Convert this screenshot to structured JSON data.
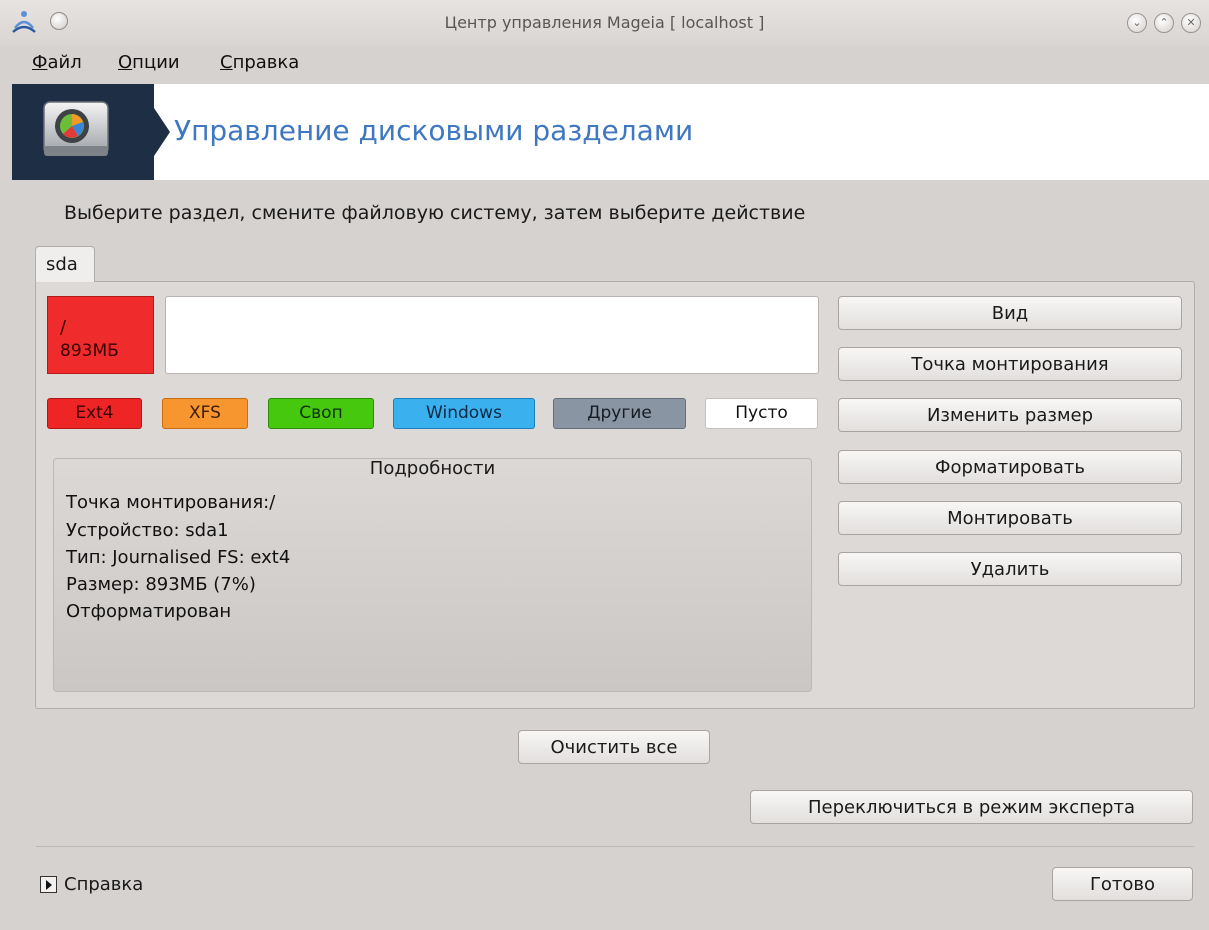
{
  "window": {
    "title": "Центр управления Mageia  [ localhost ]"
  },
  "menu": {
    "file_first": "Ф",
    "file_rest": "айл",
    "options_first": "О",
    "options_rest": "пции",
    "help_first": "С",
    "help_rest": "правка"
  },
  "banner": {
    "title": "Управление дисковыми разделами"
  },
  "instruction": "Выберите раздел, смените файловую систему, затем выберите действие",
  "tab": {
    "label": "sda"
  },
  "partition": {
    "mount": "/",
    "size": "893МБ",
    "color": "#ef2b2b"
  },
  "legend": [
    {
      "label": "Ext4",
      "color": "#ef2525"
    },
    {
      "label": "XFS",
      "color": "#f7952f"
    },
    {
      "label": "Своп",
      "color": "#45c80e"
    },
    {
      "label": "Windows",
      "color": "#3bb0ee"
    },
    {
      "label": "Другие",
      "color": "#8a95a4"
    },
    {
      "label": "Пусто",
      "color": "#ffffff"
    }
  ],
  "details": {
    "title": "Подробности",
    "lines": [
      "Точка монтирования:/",
      "Устройство: sda1",
      "Тип: Journalised FS: ext4",
      "Размер: 893МБ (7%)",
      "Отформатирован"
    ]
  },
  "actions": [
    "Вид",
    "Точка монтирования",
    "Изменить размер",
    "Форматировать",
    "Монтировать",
    "Удалить"
  ],
  "buttons": {
    "clear_all": "Очистить все",
    "expert_mode": "Переключиться в режим эксперта",
    "done": "Готово"
  },
  "help": {
    "label": "Справка"
  },
  "colors": {
    "banner_dark": "#1e2f45",
    "banner_title": "#3f77c0",
    "window_bg": "#d6d2d0"
  },
  "icons": {
    "app": "mageia-logo-icon",
    "banner": "hard-disk-icon"
  }
}
